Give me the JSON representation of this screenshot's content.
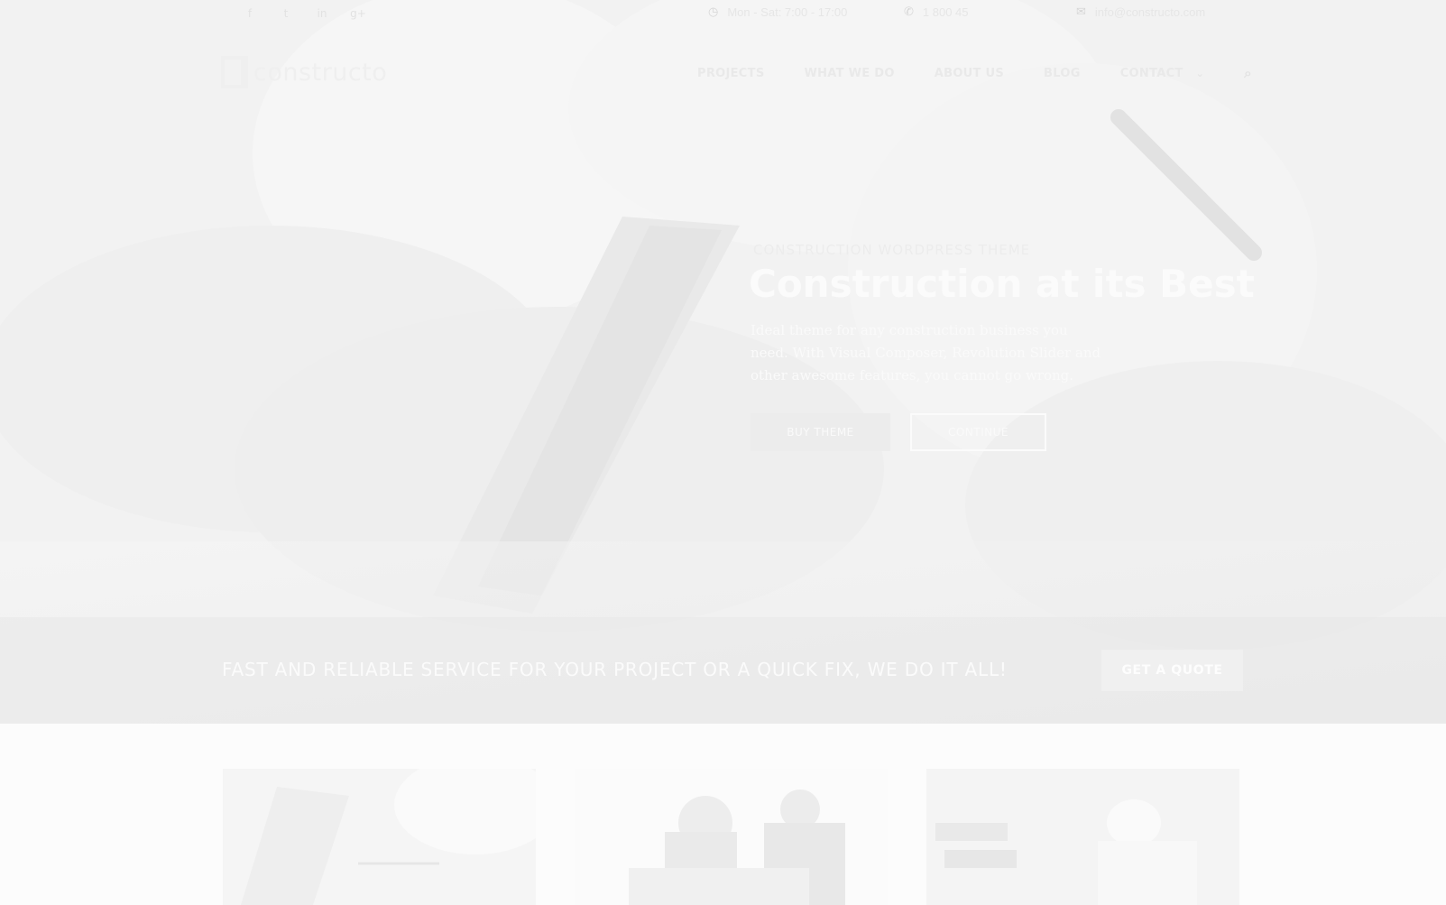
{
  "topbar": {
    "social": [
      {
        "name": "facebook-icon",
        "glyph": "f"
      },
      {
        "name": "twitter-icon",
        "glyph": "t"
      },
      {
        "name": "linkedin-icon",
        "glyph": "in"
      },
      {
        "name": "googleplus-icon",
        "glyph": "g+"
      }
    ],
    "hours": "Mon - Sat: 7:00 - 17:00",
    "phone": "1 800 45",
    "email": "info@constructo.com"
  },
  "header": {
    "logo_text": "constructo",
    "nav": [
      "PROJECTS",
      "WHAT WE DO",
      "ABOUT US",
      "BLOG",
      "CONTACT"
    ]
  },
  "hero": {
    "pretitle": "CONSTRUCTION WORDPRESS THEME",
    "title": "Construction at its Best",
    "text": "Ideal theme for any construction business you need. With Visual Composer, Revolution Slider and other awesome features, you cannot go wrong.",
    "buy_label": "BUY THEME",
    "continue_label": "CONTINUE"
  },
  "cta": {
    "text": "FAST AND RELIABLE SERVICE FOR YOUR PROJECT OR A QUICK FIX, WE DO IT ALL!",
    "button_label": "GET A QUOTE"
  },
  "icons": {
    "hours": "clock-icon",
    "phone": "phone-icon",
    "email": "envelope-icon",
    "search": "search-icon",
    "dropdown": "chevron-down-icon"
  }
}
